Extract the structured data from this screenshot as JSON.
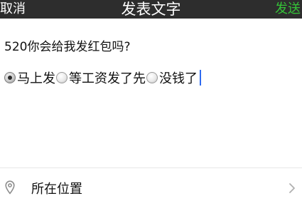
{
  "header": {
    "cancel_label": "取消",
    "title": "发表文字",
    "send_label": "发送",
    "send_color": "#35c238",
    "bg_color": "#2d2d2d"
  },
  "composer": {
    "text_line": "520你会给我发红包吗?",
    "options": [
      {
        "label": "马上发",
        "checked": true
      },
      {
        "label": "等工资发了先",
        "checked": false
      },
      {
        "label": "没钱了",
        "checked": false
      }
    ],
    "cursor_color": "#2f6bf0"
  },
  "location": {
    "label": "所在位置",
    "icon": "location-pin-icon",
    "chevron_icon": "chevron-right-icon"
  }
}
